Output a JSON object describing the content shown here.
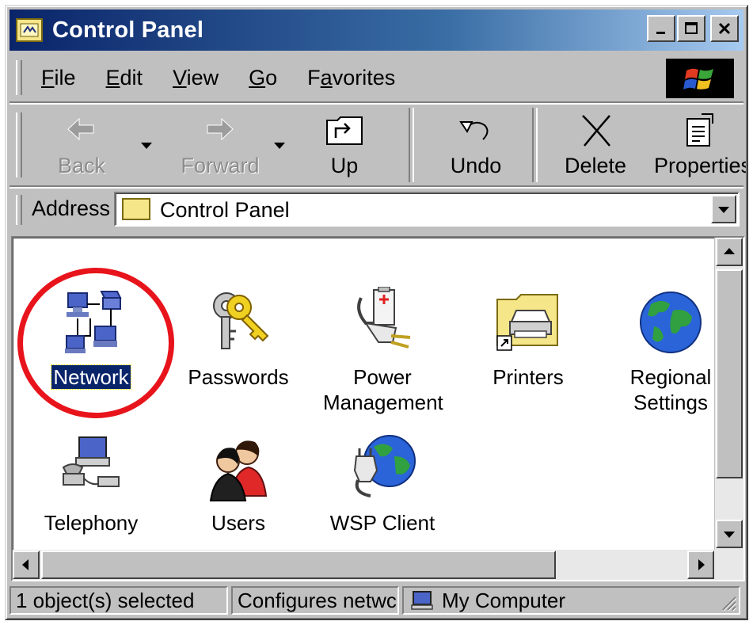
{
  "window": {
    "title": "Control Panel"
  },
  "window_controls": {
    "minimize": "_",
    "maximize": "□",
    "close": "✕"
  },
  "menubar": {
    "items": [
      {
        "label": "File",
        "accel": "F",
        "rest": "ile"
      },
      {
        "label": "Edit",
        "accel": "E",
        "rest": "dit"
      },
      {
        "label": "View",
        "accel": "V",
        "rest": "iew"
      },
      {
        "label": "Go",
        "accel": "G",
        "rest": "o"
      },
      {
        "label": "Favorites",
        "pre": "F",
        "accel": "a",
        "rest": "vorites"
      }
    ]
  },
  "toolbar": {
    "back": "Back",
    "forward": "Forward",
    "up": "Up",
    "undo": "Undo",
    "delete": "Delete",
    "properties": "Properties"
  },
  "address": {
    "label": "Address",
    "value": "Control Panel"
  },
  "icons": [
    {
      "label": "Network",
      "icon": "network-icon",
      "selected": true
    },
    {
      "label": "Passwords",
      "icon": "keys-icon"
    },
    {
      "label": "Power Management",
      "icon": "power-plug-icon"
    },
    {
      "label": "Printers",
      "icon": "printer-folder-icon"
    },
    {
      "label": "Regional Settings",
      "icon": "globe-icon"
    },
    {
      "label": "Telephony",
      "icon": "telephone-computer-icon"
    },
    {
      "label": "Users",
      "icon": "users-icon"
    },
    {
      "label": "WSP Client",
      "icon": "wsp-globe-plug-icon"
    }
  ],
  "statusbar": {
    "selection": "1 object(s) selected",
    "description": "Configures netwc",
    "zone": "My Computer"
  },
  "colors": {
    "highlight": "#0a246a",
    "annotation_circle": "#e8141c",
    "titlebar_start": "#0a246a"
  }
}
